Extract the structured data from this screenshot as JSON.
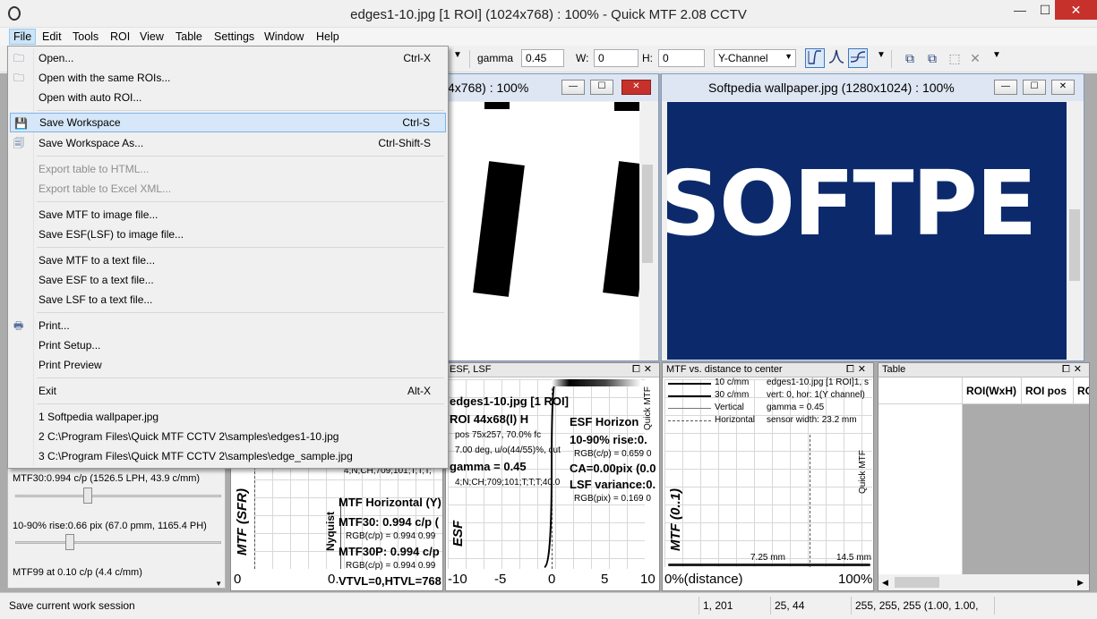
{
  "window": {
    "title": "edges1-10.jpg [1 ROI] (1024x768) : 100% - Quick MTF 2.08 CCTV",
    "min_glyph": "—",
    "max_glyph": "☐",
    "close_glyph": "✕"
  },
  "menubar": [
    "File",
    "Edit",
    "Tools",
    "ROI",
    "View",
    "Table",
    "Settings",
    "Window",
    "Help"
  ],
  "toolbar": {
    "gamma_label": "gamma",
    "gamma_value": "0.45",
    "w_label": "W:",
    "w_value": "0",
    "h_label": "H:",
    "h_value": "0",
    "channel": "Y-Channel"
  },
  "file_menu": {
    "items": [
      {
        "label": "Open...",
        "shortcut": "Ctrl-X"
      },
      {
        "label": "Open with the same ROIs..."
      },
      {
        "label": "Open with auto ROI..."
      },
      {
        "label": "Save Workspace",
        "shortcut": "Ctrl-S"
      },
      {
        "label": "Save Workspace As...",
        "shortcut": "Ctrl-Shift-S"
      },
      {
        "label": "Export table to HTML..."
      },
      {
        "label": "Export table to Excel XML..."
      },
      {
        "label": "Save MTF to image file..."
      },
      {
        "label": "Save ESF(LSF) to image file..."
      },
      {
        "label": "Save MTF to a text file..."
      },
      {
        "label": "Save ESF to a text file..."
      },
      {
        "label": "Save LSF to a text file..."
      },
      {
        "label": "Print..."
      },
      {
        "label": "Print Setup..."
      },
      {
        "label": "Print Preview"
      },
      {
        "label": "Exit",
        "shortcut": "Alt-X"
      },
      {
        "label": "1 Softpedia wallpaper.jpg"
      },
      {
        "label": "2 C:\\Program Files\\Quick MTF CCTV 2\\samples\\edges1-10.jpg"
      },
      {
        "label": "3 C:\\Program Files\\Quick MTF CCTV 2\\samples\\edge_sample.jpg"
      }
    ]
  },
  "image_window_1": {
    "title": "4x768) : 100%"
  },
  "image_window_2": {
    "title": "Softpedia wallpaper.jpg (1280x1024) : 100%",
    "image_text": "SOFTPE",
    "bg_color": "#0c2a6b"
  },
  "mtf_panel": {
    "ylabel": "MTF (SFR)",
    "nyquist": "Nyquist",
    "lines": [
      "4;N;CH;709;101;T;T;T;",
      "MTF Horizontal (Y)",
      "MTF30: 0.994 c/p (",
      "RGB(c/p) = 0.994 0.99",
      "MTF30P: 0.994 c/p",
      "RGB(c/p) = 0.994 0.99",
      "VTVL=0,HTVL=768"
    ],
    "axis": [
      "0",
      "0."
    ]
  },
  "esf_panel": {
    "title": "ESF, LSF",
    "ylabel": "ESF",
    "lines": [
      "edges1-10.jpg [1 ROI]",
      "ROI 44x68(l) H",
      "pos 75x257, 70.0% fc",
      "7.00 deg, u/o(44/55)%, cut",
      "gamma = 0.45",
      "4;N;CH;709;101;T;T;T;40.0",
      "ESF Horizon",
      "10-90% rise:0.",
      "RGB(c/p) = 0.659 0",
      "CA=0.00pix (0.0",
      "LSF variance:0.",
      "RGB(pix) = 0.169 0"
    ],
    "right_label": "Quick MTF",
    "axis": [
      "-10",
      "-5",
      "0",
      "5",
      "10"
    ]
  },
  "dist_panel": {
    "title": "MTF vs. distance to center",
    "legend": [
      "10 c/mm",
      "30 c/mm",
      "Vertical",
      "Horizontal"
    ],
    "info": [
      "edges1-10.jpg [1 ROI]1, s",
      "vert: 0, hor: 1(Y channel)",
      "gamma = 0.45",
      "sensor width: 23.2 mm"
    ],
    "ylabel": "MTF (0..1)",
    "right_label": "Quick MTF",
    "tick_labels": [
      "7.25 mm",
      "14.5 mm"
    ],
    "axis_left": "0%(distance)",
    "axis_right": "100%"
  },
  "table_panel": {
    "title": "Table",
    "headers": [
      "ROI(WxH)",
      "ROI pos",
      "RO"
    ]
  },
  "left_panel": {
    "mtf30": "MTF30:0.994 c/p (1526.5 LPH, 43.9 c/mm)",
    "rise": "10-90% rise:0.66 pix (67.0 pmm, 1165.4 PH)",
    "mtf99": "MTF99 at 0.10 c/p (4.4 c/mm)"
  },
  "statusbar": {
    "message": "Save current work session",
    "pos": "1, 201",
    "size": "25, 44",
    "rgb": "255, 255, 255 (1.00, 1.00, 1.00)"
  },
  "colors": {
    "accent": "#3b79c5",
    "close": "#c7312b",
    "hover": "#d5e7f8"
  }
}
